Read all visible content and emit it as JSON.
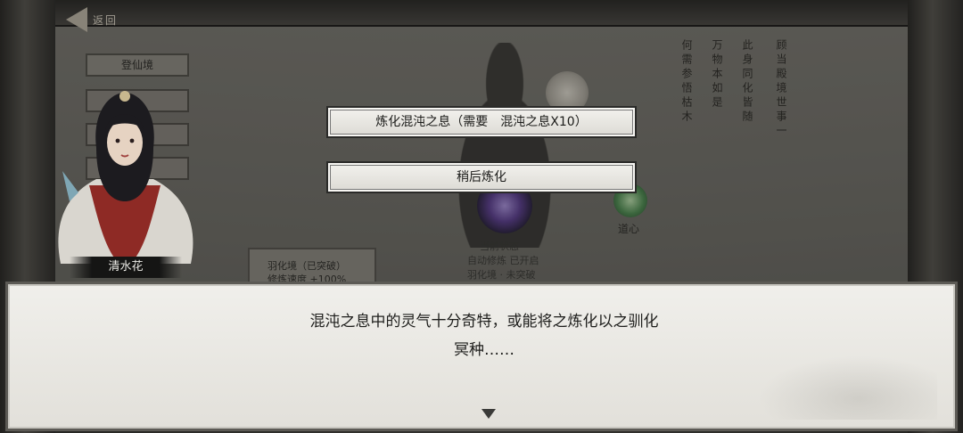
{
  "header": {
    "back_label": "返回"
  },
  "background": {
    "realm_button": "登仙境",
    "mind_label": "道心",
    "status_lines": [
      "当前状态",
      "自动修炼 已开启",
      "羽化境 · 未突破"
    ],
    "info_panel_lines": [
      "羽化境（已突破）",
      "修炼速度 +100%"
    ],
    "poem_columns": [
      "万物本如是",
      "此身同化皆随",
      "何需参悟枯木",
      "顾当殿境世事一"
    ]
  },
  "options": [
    {
      "label": "炼化混沌之息（需要　混沌之息X10）"
    },
    {
      "label": "稍后炼化"
    }
  ],
  "speaker": {
    "name": "清水花"
  },
  "dialogue": {
    "line1": "混沌之息中的灵气十分奇特，或能将之炼化以之驯化",
    "line2": "冥种……"
  },
  "colors": {
    "dialog_bg": "#f0efeb",
    "option_bg": "#f3f2ee",
    "name_plate": "#151514"
  }
}
